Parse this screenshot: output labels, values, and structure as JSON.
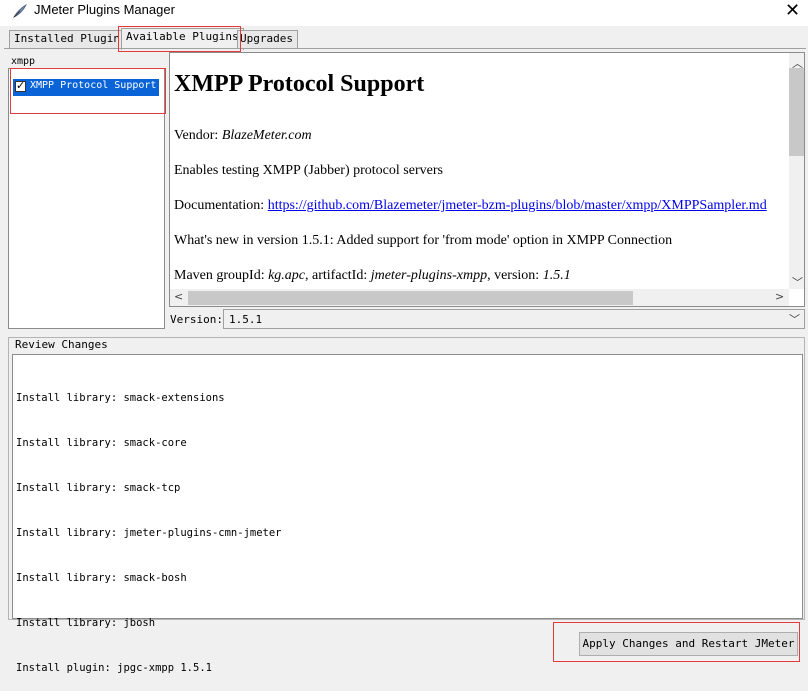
{
  "window": {
    "title": "JMeter Plugins Manager",
    "icon": "jmeter-feather-icon",
    "close_glyph": "✕"
  },
  "tabs": [
    {
      "label": "Installed Plugins"
    },
    {
      "label": "Available Plugins"
    },
    {
      "label": "Upgrades"
    }
  ],
  "search": {
    "value": "xmpp"
  },
  "plugin_list": [
    {
      "label": "XMPP Protocol Support",
      "checked": true,
      "selected": true
    }
  ],
  "details": {
    "heading": "XMPP Protocol Support",
    "vendor_label": "Vendor: ",
    "vendor": "BlazeMeter.com",
    "description": "Enables testing XMPP (Jabber) protocol servers",
    "doc_label": "Documentation: ",
    "doc_link": "https://github.com/Blazemeter/jmeter-bzm-plugins/blob/master/xmpp/XMPPSampler.md",
    "whatsnew": "What's new in version 1.5.1: Added support for 'from mode' option in XMPP Connection",
    "maven_prefix": "Maven groupId: ",
    "group_id": "kg.apc",
    "artifact_label": ", artifactId: ",
    "artifact_id": "jmeter-plugins-xmpp",
    "version_label_inline": ", version: ",
    "version_inline": "1.5.1"
  },
  "version": {
    "label": "Version:",
    "value": "1.5.1"
  },
  "review": {
    "title": "Review Changes",
    "lines": [
      "Install library: smack-extensions",
      "Install library: smack-core",
      "Install library: smack-tcp",
      "Install library: jmeter-plugins-cmn-jmeter",
      "Install library: smack-bosh",
      "Install library: jbosh",
      "Install plugin: jpgc-xmpp 1.5.1"
    ]
  },
  "apply_button": {
    "label": "Apply Changes and Restart JMeter"
  },
  "colors": {
    "highlight": "#0a64d8",
    "annotation_red": "#e23b3b",
    "link": "#0000ee"
  }
}
